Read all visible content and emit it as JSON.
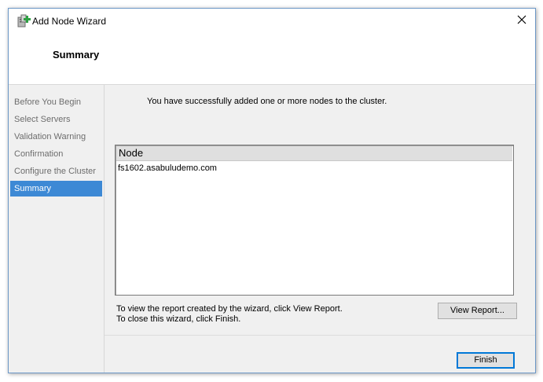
{
  "window": {
    "title": "Add Node Wizard",
    "app_icon": "cluster-node-add-icon",
    "close_icon": "close-icon"
  },
  "header": {
    "title": "Summary"
  },
  "sidebar": {
    "steps": [
      {
        "label": "Before You Begin",
        "active": false
      },
      {
        "label": "Select Servers",
        "active": false
      },
      {
        "label": "Validation Warning",
        "active": false
      },
      {
        "label": "Confirmation",
        "active": false
      },
      {
        "label": "Configure the Cluster",
        "active": false
      },
      {
        "label": "Summary",
        "active": true
      }
    ]
  },
  "main": {
    "message": "You have successfully added one or more nodes to the cluster.",
    "list": {
      "columns": [
        "Node"
      ],
      "rows": [
        "fs1602.asabuludemo.com"
      ]
    },
    "info_lines": [
      "To view the report created by the wizard, click View Report.",
      "To close this wizard, click Finish."
    ],
    "view_report_label": "View Report...",
    "finish_label": "Finish"
  },
  "colors": {
    "accent": "#3d89d5",
    "window_border": "#6b97c7",
    "body_bg": "#f0f0f0"
  }
}
